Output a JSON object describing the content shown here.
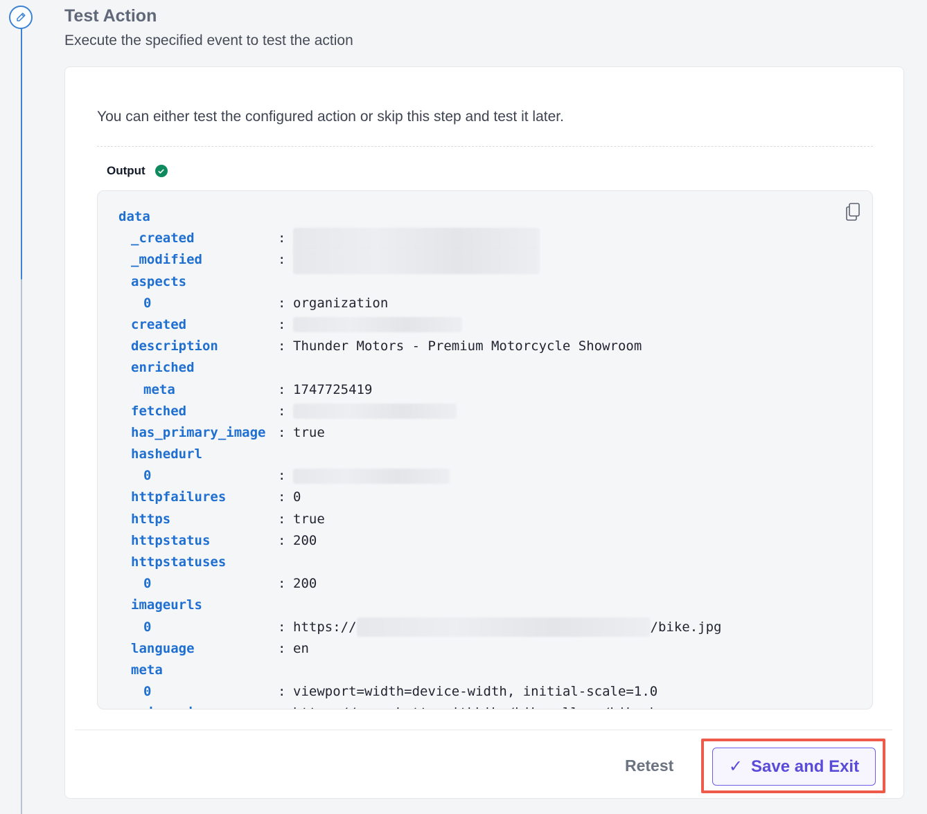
{
  "step": {
    "title": "Test Action",
    "subtitle": "Execute the specified event to test the action",
    "icon": "pencil-icon"
  },
  "card": {
    "intro": "You can either test the configured action or skip this step and test it later.",
    "output_label": "Output",
    "output_status": "success",
    "copy_icon": "copy-icon"
  },
  "output": {
    "root_key": "data",
    "rows": [
      {
        "key": "_created",
        "indent": 1,
        "value": null,
        "redacted": true,
        "redact_width": 356,
        "redact_height": 36
      },
      {
        "key": "_modified",
        "indent": 1,
        "value": null,
        "redacted": true,
        "redact_width": 356,
        "redact_height": 36
      },
      {
        "key": "aspects",
        "indent": 1,
        "value": null,
        "redacted": false
      },
      {
        "key": "0",
        "indent": 2,
        "value": "organization",
        "redacted": false
      },
      {
        "key": "created",
        "indent": 1,
        "value": null,
        "redacted": true,
        "redact_width": 244,
        "redact_height": 22
      },
      {
        "key": "description",
        "indent": 1,
        "value": "Thunder Motors - Premium Motorcycle Showroom",
        "redacted": false
      },
      {
        "key": "enriched",
        "indent": 1,
        "value": null,
        "redacted": false
      },
      {
        "key": "meta",
        "indent": 2,
        "value": "1747725419",
        "redacted": false
      },
      {
        "key": "fetched",
        "indent": 1,
        "value": null,
        "redacted": true,
        "redact_width": 236,
        "redact_height": 22
      },
      {
        "key": "has_primary_image",
        "indent": 1,
        "value": "true",
        "redacted": false
      },
      {
        "key": "hashedurl",
        "indent": 1,
        "value": null,
        "redacted": false
      },
      {
        "key": "0",
        "indent": 2,
        "value": null,
        "redacted": true,
        "redact_width": 226,
        "redact_height": 22
      },
      {
        "key": "httpfailures",
        "indent": 1,
        "value": "0",
        "redacted": false
      },
      {
        "key": "https",
        "indent": 1,
        "value": "true",
        "redacted": false
      },
      {
        "key": "httpstatus",
        "indent": 1,
        "value": "200",
        "redacted": false
      },
      {
        "key": "httpstatuses",
        "indent": 1,
        "value": null,
        "redacted": false
      },
      {
        "key": "0",
        "indent": 2,
        "value": "200",
        "redacted": false
      },
      {
        "key": "imageurls",
        "indent": 1,
        "value": null,
        "redacted": false
      },
      {
        "key": "0",
        "indent": 2,
        "value": "https://",
        "redacted": true,
        "redact_width": 424,
        "redact_height": 28,
        "suffix": "/bike.jpg"
      },
      {
        "key": "language",
        "indent": 1,
        "value": "en",
        "redacted": false
      },
      {
        "key": "meta",
        "indent": 1,
        "value": null,
        "redacted": false
      },
      {
        "key": "0",
        "indent": 2,
        "value": "viewport=width=device-width, initial-scale=1.0",
        "redacted": false
      },
      {
        "key": "primaryimage",
        "indent": 1,
        "value": "https://www.shutterwithbike/bikegallery/bikeph",
        "redacted": false
      }
    ]
  },
  "footer": {
    "retest_label": "Retest",
    "save_label": "Save and Exit",
    "save_icon": "check-icon",
    "highlight_color": "#ef5b4b",
    "accent_color": "#5b4bd9"
  }
}
